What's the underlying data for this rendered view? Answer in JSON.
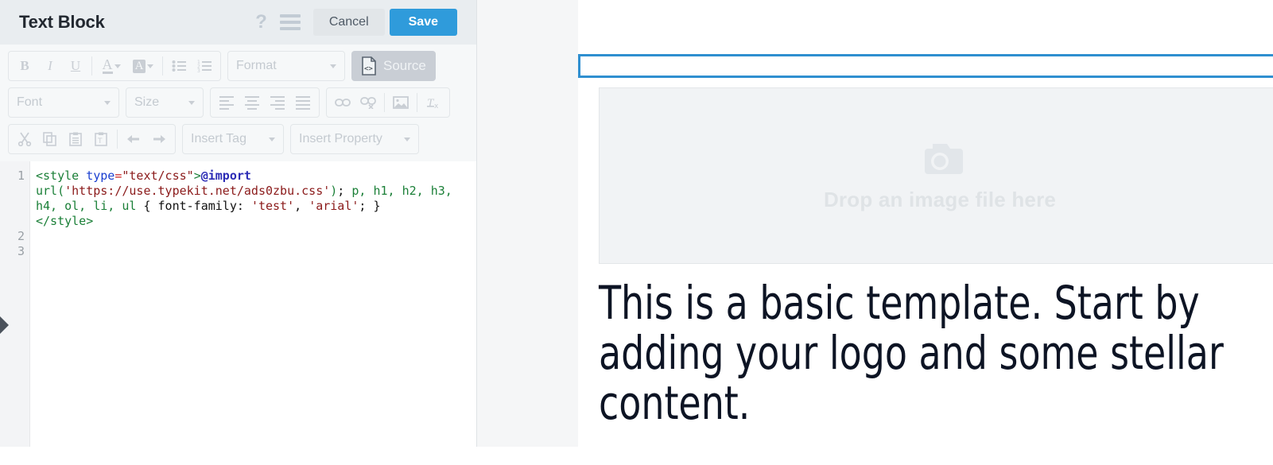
{
  "editor": {
    "title": "Text Block",
    "header_icons": [
      {
        "name": "help-icon",
        "glyph": "?"
      },
      {
        "name": "menu-icon",
        "glyph": "☰"
      }
    ],
    "cancel_label": "Cancel",
    "save_label": "Save",
    "accent_save_color": "#2f9bdb",
    "header_bg_color": "#e9edf0",
    "toolbar": {
      "row1": {
        "bold_label": "B",
        "italic_label": "I",
        "underline_label": "U",
        "text_color_label": "A",
        "bg_color_label": "A",
        "bullet_list_icon": "bulleted-list-icon",
        "numbered_list_icon": "numbered-list-icon",
        "format_placeholder": "Format",
        "source_label": "Source",
        "source_active": true
      },
      "row2": {
        "font_placeholder": "Font",
        "size_placeholder": "Size",
        "align_left_icon": "align-left-icon",
        "align_center_icon": "align-center-icon",
        "align_right_icon": "align-right-icon",
        "align_justify_icon": "align-justify-icon",
        "link_icon": "link-icon",
        "unlink_icon": "unlink-icon",
        "image_icon": "image-icon",
        "remove_format_icon": "remove-format-icon"
      },
      "row3": {
        "cut_icon": "cut-icon",
        "copy_icon": "copy-icon",
        "paste_icon": "paste-icon",
        "paste_text_icon": "paste-as-text-icon",
        "undo_icon": "undo-icon",
        "redo_icon": "redo-icon",
        "insert_tag_placeholder": "Insert Tag",
        "insert_property_placeholder": "Insert Property"
      }
    },
    "code": {
      "line_numbers": [
        "1",
        "2",
        "3"
      ],
      "raw": "<style type=\"text/css\">@import url('https://use.typekit.net/ads0zbu.css'); p, h1, h2, h3, h4, ol, li, ul { font-family: 'test', 'arial'; }\n</style>\n",
      "tokens": [
        {
          "t": "<style",
          "c": "tk-tag"
        },
        {
          "t": " ",
          "c": "tk-plain"
        },
        {
          "t": "type",
          "c": "tk-attr"
        },
        {
          "t": "=",
          "c": "tk-op"
        },
        {
          "t": "\"text/css\"",
          "c": "tk-str"
        },
        {
          "t": ">",
          "c": "tk-tag"
        },
        {
          "t": "@import",
          "c": "tk-at"
        },
        {
          "t": " ",
          "c": "tk-plain"
        },
        {
          "t": "url(",
          "c": "tk-fn"
        },
        {
          "t": "'https://use.typekit.net/ads0zbu.css'",
          "c": "tk-str"
        },
        {
          "t": ")",
          "c": "tk-fn"
        },
        {
          "t": "; ",
          "c": "tk-plain"
        },
        {
          "t": "p, h1, h2, h3, h4, ol, li, ul",
          "c": "tk-sel"
        },
        {
          "t": " { ",
          "c": "tk-plain"
        },
        {
          "t": "font-family",
          "c": "tk-plain"
        },
        {
          "t": ": ",
          "c": "tk-plain"
        },
        {
          "t": "'test'",
          "c": "tk-str"
        },
        {
          "t": ", ",
          "c": "tk-plain"
        },
        {
          "t": "'arial'",
          "c": "tk-str"
        },
        {
          "t": "; }",
          "c": "tk-plain"
        },
        {
          "t": "\n",
          "c": "tk-plain"
        },
        {
          "t": "</style>",
          "c": "tk-tag"
        },
        {
          "t": "\n",
          "c": "tk-plain"
        }
      ]
    },
    "collapse_arrow_icon": "collapse-panel-arrow-icon"
  },
  "preview": {
    "selected_block_border_color": "#2f8fd0",
    "image_drop": {
      "icon": "camera-icon",
      "label": "Drop an image file here"
    },
    "heading_text": "This is a basic template. Start by adding your logo and some stellar content.",
    "heading_color": "#0d1424"
  }
}
